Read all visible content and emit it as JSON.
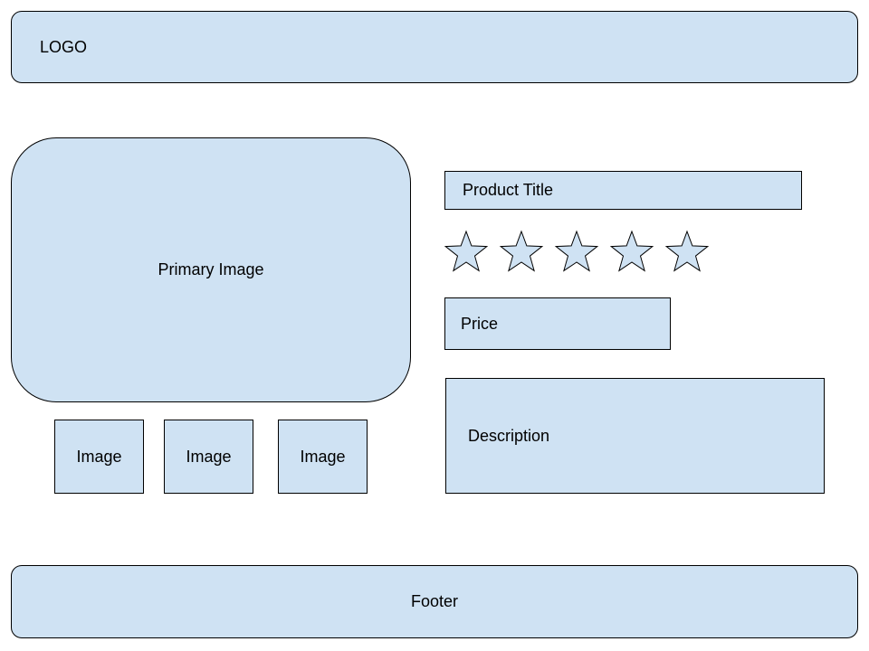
{
  "header": {
    "logo_label": "LOGO"
  },
  "gallery": {
    "primary_label": "Primary Image",
    "thumbnails": [
      "Image",
      "Image",
      "Image"
    ]
  },
  "product": {
    "title_label": "Product Title",
    "rating_stars": 5,
    "price_label": "Price",
    "description_label": "Description"
  },
  "footer": {
    "label": "Footer"
  },
  "colors": {
    "box_fill": "#cfe2f3",
    "box_stroke": "#000000"
  },
  "icons": {
    "rating": "star-icon"
  }
}
